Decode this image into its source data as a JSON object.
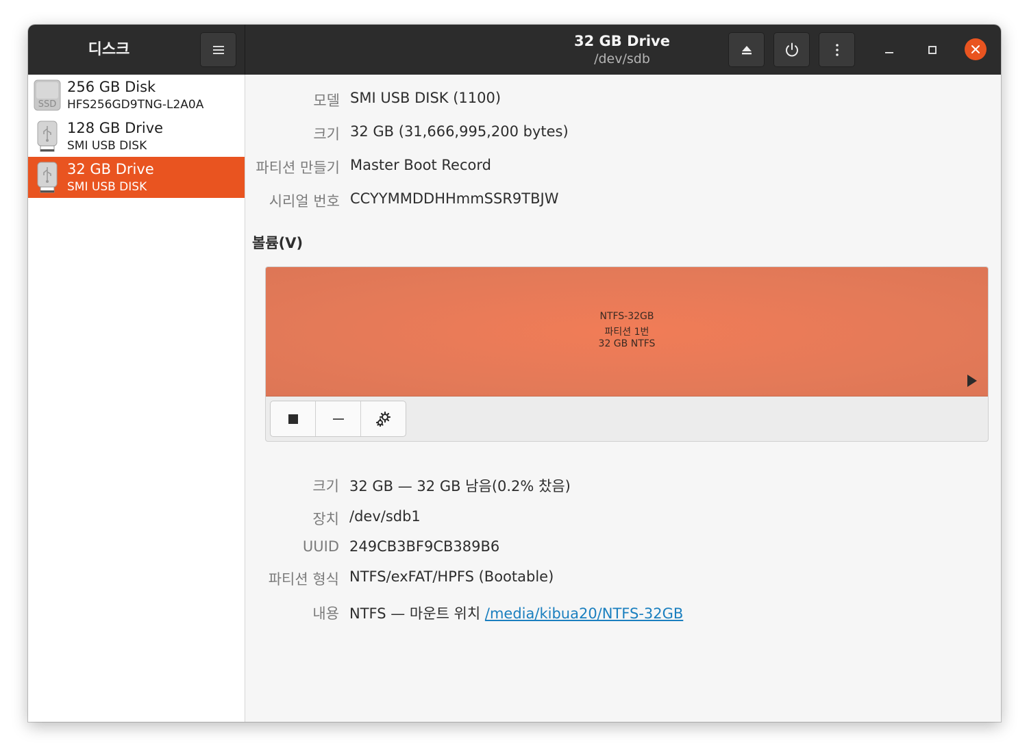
{
  "header": {
    "app_title": "디스크",
    "drive_title": "32 GB Drive",
    "drive_subtitle": "/dev/sdb"
  },
  "sidebar": {
    "items": [
      {
        "name": "256 GB Disk",
        "model": "HFS256GD9TNG-L2A0A",
        "icon": "ssd-drive-icon",
        "icon_label": "SSD",
        "selected": false
      },
      {
        "name": "128 GB Drive",
        "model": "SMI USB DISK",
        "icon": "usb-drive-icon",
        "selected": false
      },
      {
        "name": "32 GB Drive",
        "model": "SMI USB DISK",
        "icon": "usb-drive-icon",
        "selected": true
      }
    ]
  },
  "drive_props": [
    {
      "label": "모델",
      "value": "SMI USB DISK (1100)"
    },
    {
      "label": "크기",
      "value": "32 GB (31,666,995,200 bytes)"
    },
    {
      "label": "파티션 만들기",
      "value": "Master Boot Record"
    },
    {
      "label": "시리얼 번호",
      "value": "CCYYMMDDHHmmSSR9TBJW"
    }
  ],
  "volumes": {
    "heading": "볼륨(V)",
    "partition": {
      "line1": "NTFS-32GB",
      "line2": "파티션 1번",
      "line3": "32 GB NTFS"
    }
  },
  "volume_props": {
    "size": {
      "label": "크기",
      "value": "32 GB — 32 GB 남음(0.2% 찼음)"
    },
    "device": {
      "label": "장치",
      "value": "/dev/sdb1"
    },
    "uuid": {
      "label": "UUID",
      "value": "249CB3BF9CB389B6"
    },
    "partition_type": {
      "label": "파티션 형식",
      "value": "NTFS/exFAT/HPFS (Bootable)"
    },
    "contents": {
      "label": "내용",
      "value": "NTFS — 마운트 위치 ",
      "link": "/media/kibua20/NTFS-32GB"
    }
  },
  "colors": {
    "accent": "#e95420",
    "header_bg": "#2c2c2c",
    "partition_fill": "#e47a58",
    "link": "#1a7fbf"
  }
}
